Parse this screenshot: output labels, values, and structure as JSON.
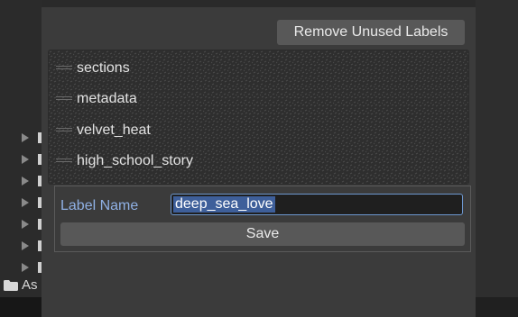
{
  "colors": {
    "background": "#232323",
    "popup_bg": "#3b3b3b",
    "list_bg": "#2d2d2d",
    "button_bg": "#585858",
    "accent_blue": "#6d97cf",
    "selection": "#3e5f9a",
    "field_label": "#8fb0e4"
  },
  "hierarchy": {
    "partial_text": "As",
    "folder_icon": "folder-icon"
  },
  "popup": {
    "remove_unused_label": "Remove Unused Labels",
    "labels": [
      {
        "name": "sections"
      },
      {
        "name": "metadata"
      },
      {
        "name": "velvet_heat"
      },
      {
        "name": "high_school_story"
      }
    ],
    "edit": {
      "field_label": "Label Name",
      "value": "deep_sea_love",
      "save_label": "Save"
    }
  }
}
